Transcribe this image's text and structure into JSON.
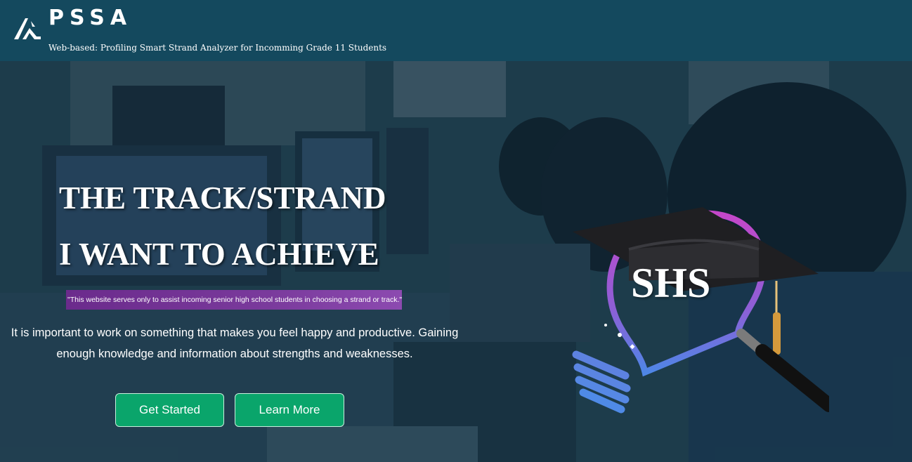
{
  "header": {
    "brand": "PSSA",
    "tagline": "Web-based: Profiling Smart Strand Analyzer for Incomming Grade 11 Students",
    "logo_icon": "pssa-logo-icon"
  },
  "hero": {
    "headline_line1": "THE TRACK/STRAND",
    "headline_line2": "I WANT TO ACHIEVE",
    "disclaimer": "\"This website serves only to assist incoming senior high school students in choosing a strand or track.\"",
    "description": "It is important to work on something that makes you feel happy and productive. Gaining enough knowledge and information about strengths and weaknesses.",
    "illustration_text": "SHS",
    "buttons": {
      "get_started": "Get Started",
      "learn_more": "Learn More"
    }
  },
  "colors": {
    "header_bg": "#14495e",
    "button_bg": "#0aa56b",
    "disclaimer_bg": "#7a3a9c"
  }
}
